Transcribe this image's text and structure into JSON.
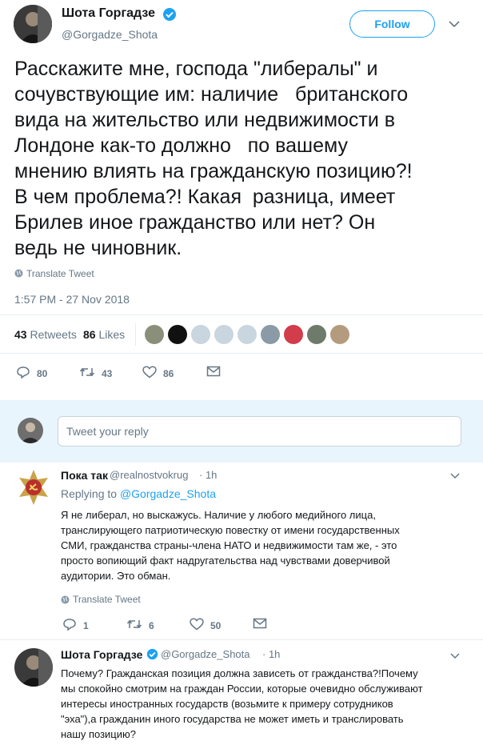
{
  "tweet": {
    "author_name": "Шота Горгадзе",
    "author_handle": "@Gorgadze_Shota",
    "follow_label": "Follow",
    "text": "Расскажите мне, господа \"либералы\" и\nсочувствующие им: наличие   британского\nвида на жительство или недвижимости в\nЛондоне как-то должно   по вашему\nмнению влиять на гражданскую позицию?!\nВ чем проблема?! Какая  разница, имеет\nБрилев иное гражданство или нет? Он\nведь не чиновник.",
    "translate_label": "Translate Tweet",
    "timestamp": "1:57 PM - 27 Nov 2018",
    "retweets_count": "43",
    "retweets_label": "Retweets",
    "likes_count": "86",
    "likes_label": "Likes",
    "likers": [
      {
        "icon": "avatar-photo-1",
        "color": "#8a8f7a"
      },
      {
        "icon": "avatar-dark-2",
        "color": "#111111"
      },
      {
        "icon": "avatar-default-3",
        "color": "#c9d6df"
      },
      {
        "icon": "avatar-default-4",
        "color": "#c9d6df"
      },
      {
        "icon": "avatar-default-5",
        "color": "#c9d6df"
      },
      {
        "icon": "avatar-photo-6",
        "color": "#8a9aa6"
      },
      {
        "icon": "avatar-flag-7",
        "color": "#d23c4b"
      },
      {
        "icon": "avatar-photo-8",
        "color": "#6e7a6a"
      },
      {
        "icon": "avatar-photo-9",
        "color": "#b59b7e"
      }
    ],
    "actions": {
      "reply_count": "80",
      "retweet_count": "43",
      "like_count": "86"
    }
  },
  "reply_box": {
    "placeholder": "Tweet your reply"
  },
  "replies": [
    {
      "author_name": "Пока так",
      "author_handle": "@realnostvokrug",
      "time": "· 1h",
      "replying_prefix": "Replying to",
      "replying_to": "@Gorgadze_Shota",
      "text": "Я не либерал, но выскажусь. Наличие у любого медийного лица,\nтранслирующего патриотическую повестку от имени государственных\nСМИ, гражданства страны-члена НАТО и недвижимости там же, - это\nпросто вопиющий факт надругательства над чувствами доверчивой\nаудитории. Это обман.",
      "translate_label": "Translate Tweet",
      "reply_count": "1",
      "retweet_count": "6",
      "like_count": "50"
    },
    {
      "author_name": "Шота Горгадзе",
      "author_handle": "@Gorgadze_Shota",
      "time": "· 1h",
      "text": "Почему? Гражданская позиция должна зависеть от гражданства?!Почему\nмы спокойно смотрим на граждан России, которые очевидно обслуживают\nинтересы иностранных государств (возьмите к примеру сотрудников\n\"эха\"),а гражданин иного государства не может иметь и транслировать\nнашу позицию?"
    }
  ],
  "colors": {
    "accent": "#1da1f2",
    "muted": "#657786",
    "text": "#14171a"
  }
}
